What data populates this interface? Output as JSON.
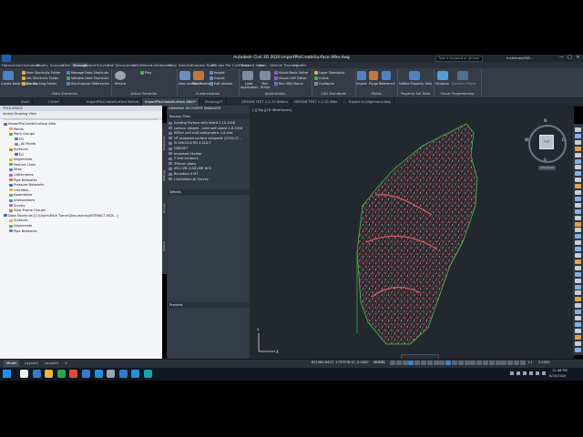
{
  "title": "Autodesk Civil 3D 2020  ImportPtsCreateSurface After.dwg",
  "search_placeholder": "Type a keyword or phrase",
  "user": "mckinney006...",
  "window_controls": [
    "—",
    "□",
    "✕"
  ],
  "menu": [
    "Home",
    "Insert",
    "Annotate",
    "Modify",
    "Analyze",
    "View",
    "Manage",
    "Output",
    "Survey",
    "Rail",
    "Transparent",
    "InfraWorks",
    "Collaborate",
    "Help",
    "Add-ins",
    "Express Tools",
    "SRLabs Por Civil Tools",
    "Featured Apps",
    "Rom",
    "Vehicle Tracking",
    "Autoflir"
  ],
  "active_menu": "Manage",
  "ribbon": {
    "left_buttons": [
      "Create Data Shortcuts"
    ],
    "data_shortcuts": [
      "New Shortcuts Folder",
      "Set Shortcuts Folder",
      "Set Working Folder",
      "Manage Data Shortcuts",
      "Validate Data Shortcuts",
      "Synchronize References"
    ],
    "action_recorder": [
      "Play",
      "Record"
    ],
    "customization": [
      "User Interface",
      "Tool Palettes",
      "Import",
      "Export",
      "Edit Aliases"
    ],
    "applications": [
      "Load Application",
      "Run Script",
      "Visual Basic Editor",
      "Visual LISP Editor",
      "Run VBA Macro"
    ],
    "cad_standards": [
      "Layer Translator",
      "Check",
      "Configure"
    ],
    "styles": [
      "Import",
      "Purge",
      "Reference"
    ],
    "psd": [
      "Define Property Sets"
    ],
    "vp": [
      "Dynamo",
      "Dynamo Player"
    ],
    "group_labels": [
      "Data Shortcuts",
      "Action Recorder",
      "Customization",
      "Applications",
      "CAD Standards",
      "Styles",
      "Property Set Data",
      "Visual Programming"
    ]
  },
  "doc_tabs": [
    "Start",
    "Circle*",
    "ImportPtsCreateSurface Before",
    "ImportPtsCreateSurface After*",
    "Drawing1*",
    "DESIGN TEST 1-2-19 Before",
    "DESIGN TEST 1-2-19 After",
    "Expert to Alignment.dwg"
  ],
  "active_doc_tab": "ImportPtsCreateSurface After*",
  "toolspace": {
    "title": "TOOLSPACE",
    "subtitle": "Active Drawing View",
    "tree": [
      {
        "label": "ImportPtsCreateSurface After",
        "depth": 0
      },
      {
        "label": "Points",
        "depth": 1
      },
      {
        "label": "Point Groups",
        "depth": 1
      },
      {
        "label": "EG",
        "depth": 2
      },
      {
        "label": "_All Points",
        "depth": 2
      },
      {
        "label": "Surfaces",
        "depth": 1
      },
      {
        "label": "EG",
        "depth": 2
      },
      {
        "label": "Alignments",
        "depth": 1
      },
      {
        "label": "Feature Lines",
        "depth": 1
      },
      {
        "label": "Sites",
        "depth": 1
      },
      {
        "label": "Catchments",
        "depth": 1
      },
      {
        "label": "Pipe Networks",
        "depth": 1
      },
      {
        "label": "Pressure Networks",
        "depth": 1
      },
      {
        "label": "Corridors",
        "depth": 1
      },
      {
        "label": "Assemblies",
        "depth": 1
      },
      {
        "label": "Intersections",
        "depth": 1
      },
      {
        "label": "Survey",
        "depth": 1
      },
      {
        "label": "View Frame Groups",
        "depth": 1
      },
      {
        "label": "Data Shortcuts [C:\\Users\\Mick Turner\\Documents\\INTERACT-MCK...]",
        "depth": 0
      },
      {
        "label": "Surfaces",
        "depth": 1
      },
      {
        "label": "Alignments",
        "depth": 1
      },
      {
        "label": "Pipe Networks",
        "depth": 1
      }
    ]
  },
  "side_tabs": [
    "Prospector",
    "Settings",
    "Survey",
    "Toolbox"
  ],
  "drawing_recovery": {
    "title": "DRAWING RECOVERY MANAGER",
    "backup_header": "Backup Files",
    "files": [
      "Existing Surface with faded 2-15-2018",
      "contour clipped - exist self-Latest 2-8-2018",
      "INTyre unif-nudl bathymetric 2-8-rest",
      "HT proposed surface subgrade (2020-07...",
      "IS LINCOLN RD 4-SLD.T",
      "GRIDSET",
      "Imported Hectilar",
      "2 feet contours",
      "3Polcon plans",
      "XRI-CZB (CAD)-MR NCS",
      "Boundary-4 MT",
      "LineGolden-AI-Survey"
    ],
    "details_header": "Details",
    "preview_header": "Preview"
  },
  "viewport": {
    "label": "[-][Top][2D Wireframe]",
    "viewcube_top": "TOP",
    "compass": {
      "n": "N",
      "s": "S",
      "e": "E",
      "w": "W"
    },
    "wcs": "Unnamed"
  },
  "status": {
    "layout_tabs": [
      "Model",
      "Layout1",
      "Layout2",
      "+"
    ],
    "active_layout": "Model",
    "coords": "651580.8437, 1737978.4?, 0.0000",
    "mode": "MODEL",
    "scale": "1:1",
    "units": "3.5000"
  },
  "taskbar": {
    "time": "12:46 PM",
    "date": "6/25/2020"
  },
  "colors": {
    "accent": "#1c5fa9",
    "contour_red": "#e14545",
    "contour_white": "#d8d8d8",
    "boundary_green": "#3ac24a",
    "viewport_bg": "#23282f"
  }
}
